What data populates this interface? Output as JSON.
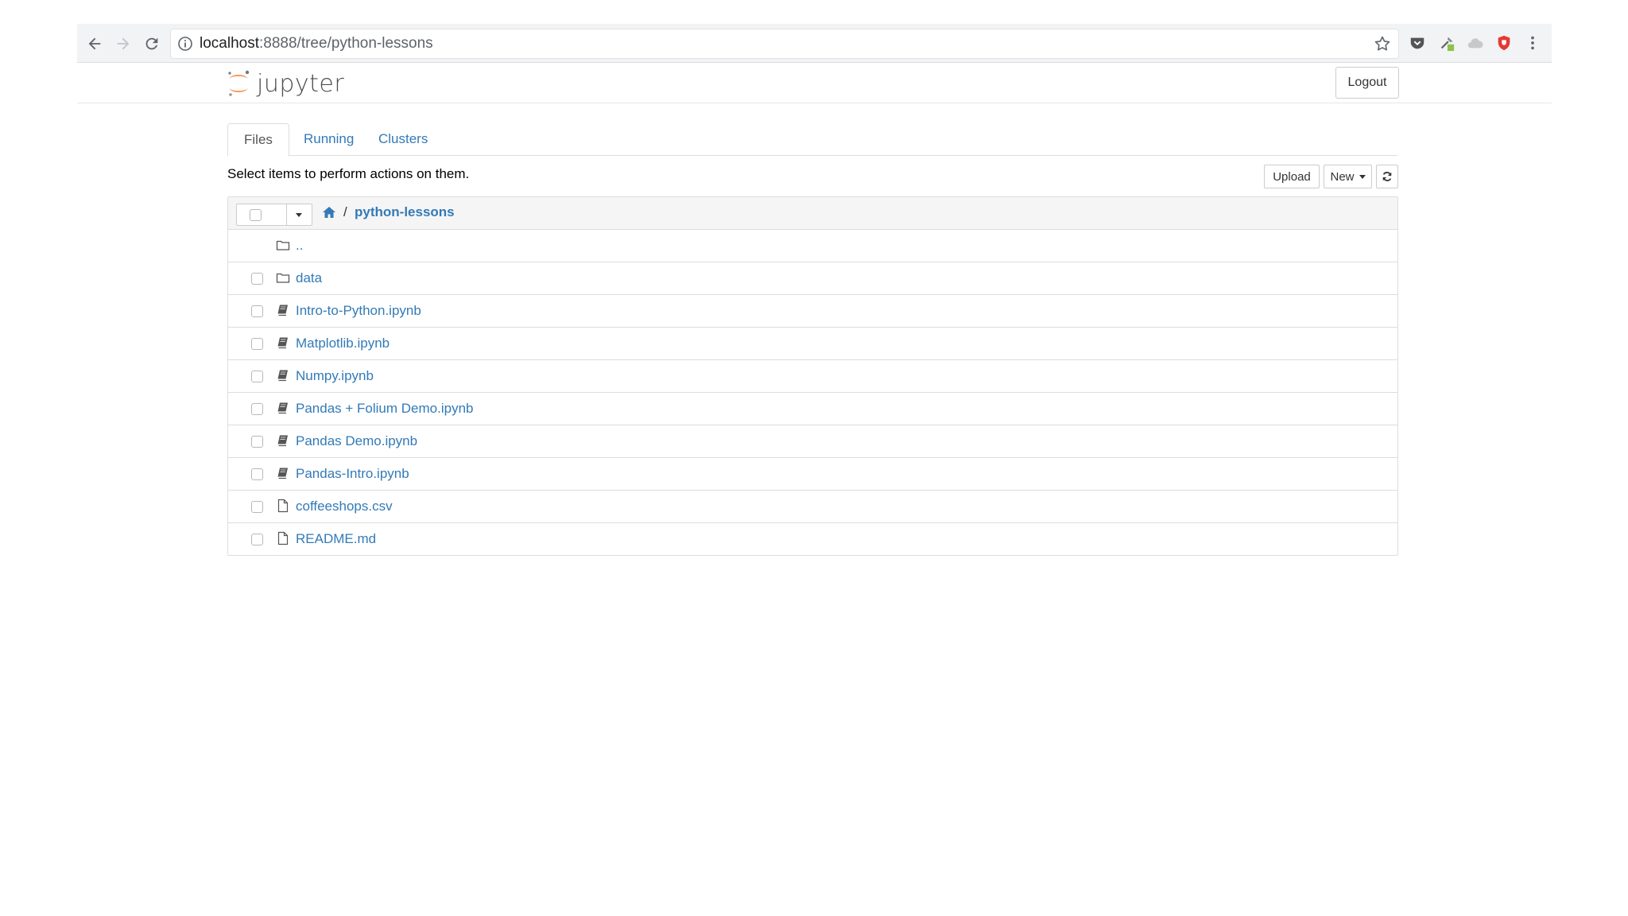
{
  "browser": {
    "url_host": "localhost",
    "url_rest": ":8888/tree/python-lessons"
  },
  "header": {
    "logo_text": "jupyter",
    "logout_label": "Logout"
  },
  "tabs": [
    {
      "label": "Files",
      "active": true
    },
    {
      "label": "Running",
      "active": false
    },
    {
      "label": "Clusters",
      "active": false
    }
  ],
  "toolbar": {
    "hint": "Select items to perform actions on them.",
    "upload_label": "Upload",
    "new_label": "New"
  },
  "breadcrumb": {
    "separator": "/",
    "current": "python-lessons"
  },
  "files": [
    {
      "name": "..",
      "type": "folder",
      "checkbox": false
    },
    {
      "name": "data",
      "type": "folder",
      "checkbox": true
    },
    {
      "name": "Intro-to-Python.ipynb",
      "type": "notebook",
      "checkbox": true
    },
    {
      "name": "Matplotlib.ipynb",
      "type": "notebook",
      "checkbox": true
    },
    {
      "name": "Numpy.ipynb",
      "type": "notebook",
      "checkbox": true
    },
    {
      "name": "Pandas + Folium Demo.ipynb",
      "type": "notebook",
      "checkbox": true
    },
    {
      "name": "Pandas Demo.ipynb",
      "type": "notebook",
      "checkbox": true
    },
    {
      "name": "Pandas-Intro.ipynb",
      "type": "notebook",
      "checkbox": true
    },
    {
      "name": "coffeeshops.csv",
      "type": "file",
      "checkbox": true
    },
    {
      "name": "README.md",
      "type": "file",
      "checkbox": true
    }
  ],
  "colors": {
    "link": "#337ab7",
    "jupyter_orange": "#f37726"
  }
}
